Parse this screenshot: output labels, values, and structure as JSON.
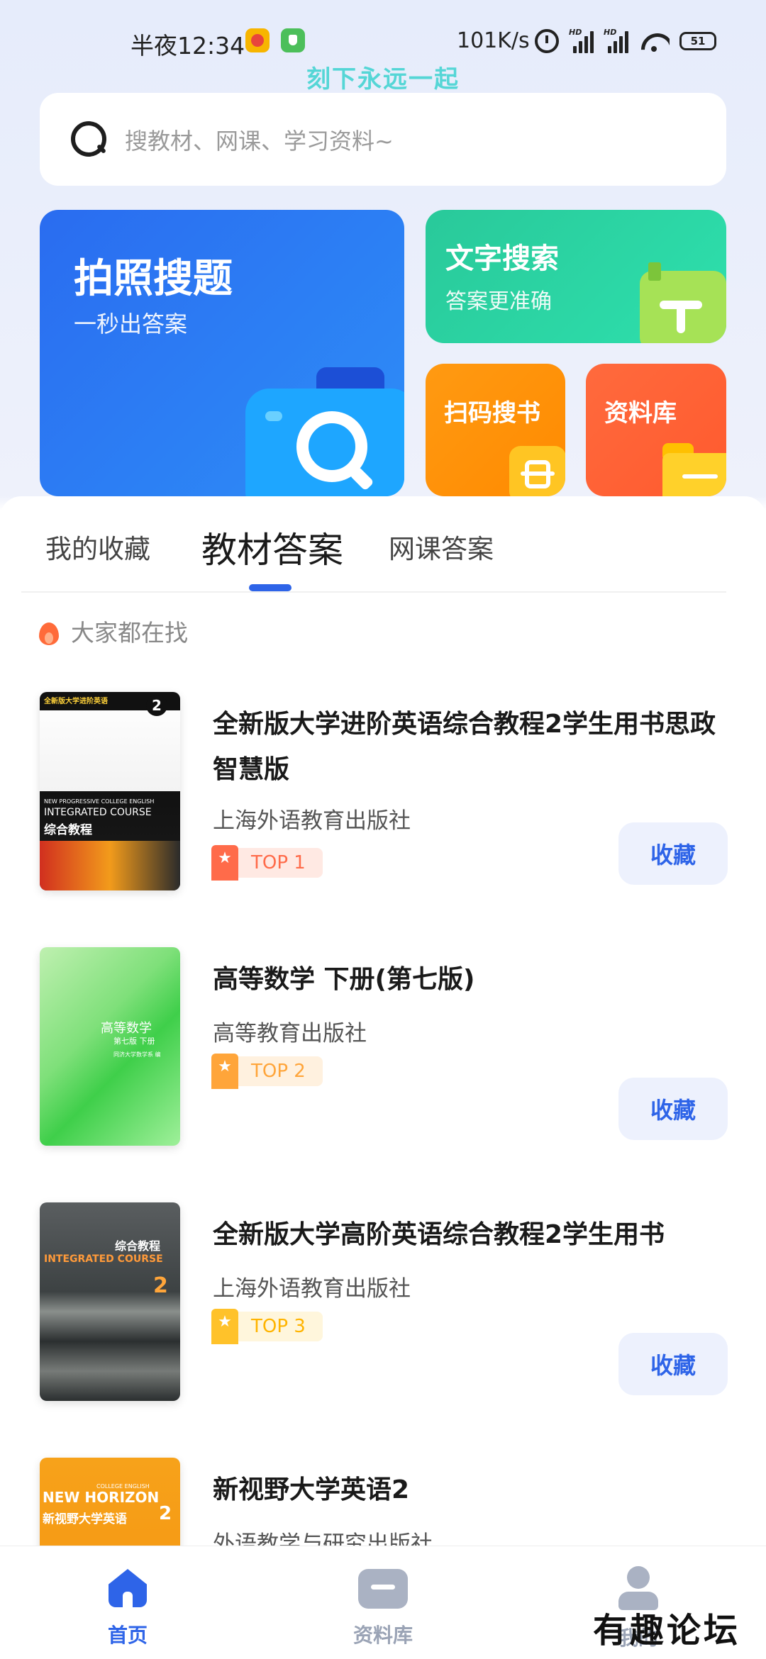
{
  "status_bar": {
    "time": "半夜12:34",
    "net_speed": "101K/s",
    "hd_label": "HD",
    "battery": "51"
  },
  "watermark_top": "刻下永远一起",
  "search": {
    "placeholder": "搜教材、网课、学习资料~"
  },
  "features": {
    "photo": {
      "title": "拍照搜题",
      "subtitle": "一秒出答案"
    },
    "text": {
      "title": "文字搜索",
      "subtitle": "答案更准确"
    },
    "scan": {
      "title": "扫码搜书"
    },
    "library": {
      "title": "资料库"
    }
  },
  "tabs": [
    {
      "label": "我的收藏"
    },
    {
      "label": "教材答案"
    },
    {
      "label": "网课答案"
    }
  ],
  "hot_section": {
    "label": "大家都在找"
  },
  "books": [
    {
      "title": "全新版大学进阶英语综合教程2学生用书思政智慧版",
      "publisher": "上海外语教育出版社",
      "rank": "TOP 1",
      "rank_color": "#ff6b4a",
      "rank_bg": "#ffe9e3",
      "fav_label": "收藏",
      "cover_texts": [
        "全新版大学进阶英语",
        "NEW PROGRESSIVE COLLEGE ENGLISH",
        "INTEGRATED COURSE",
        "综合教程",
        "2"
      ]
    },
    {
      "title": "高等数学 下册(第七版)",
      "publisher": "高等教育出版社",
      "rank": "TOP 2",
      "rank_color": "#ffa53a",
      "rank_bg": "#fff1df",
      "fav_label": "收藏",
      "cover_texts": [
        "高等数学",
        "第七版 下册",
        "同济大学数学系 编"
      ]
    },
    {
      "title": "全新版大学高阶英语综合教程2学生用书",
      "publisher": "上海外语教育出版社",
      "rank": "TOP 3",
      "rank_color": "#ffc22a",
      "rank_bg": "#fff6dc",
      "fav_label": "收藏",
      "cover_texts": [
        "综合教程",
        "INTEGRATED COURSE",
        "2"
      ]
    },
    {
      "title": "新视野大学英语2",
      "publisher": "外语教学与研究出版社",
      "cover_texts": [
        "NEW HORIZON",
        "COLLEGE ENGLISH",
        "新视野大学英语",
        "2"
      ]
    }
  ],
  "bottom_nav": [
    {
      "label": "首页",
      "active": true
    },
    {
      "label": "资料库",
      "active": false
    },
    {
      "label": "我的",
      "active": false
    }
  ],
  "watermark_bottom": "有趣论坛"
}
